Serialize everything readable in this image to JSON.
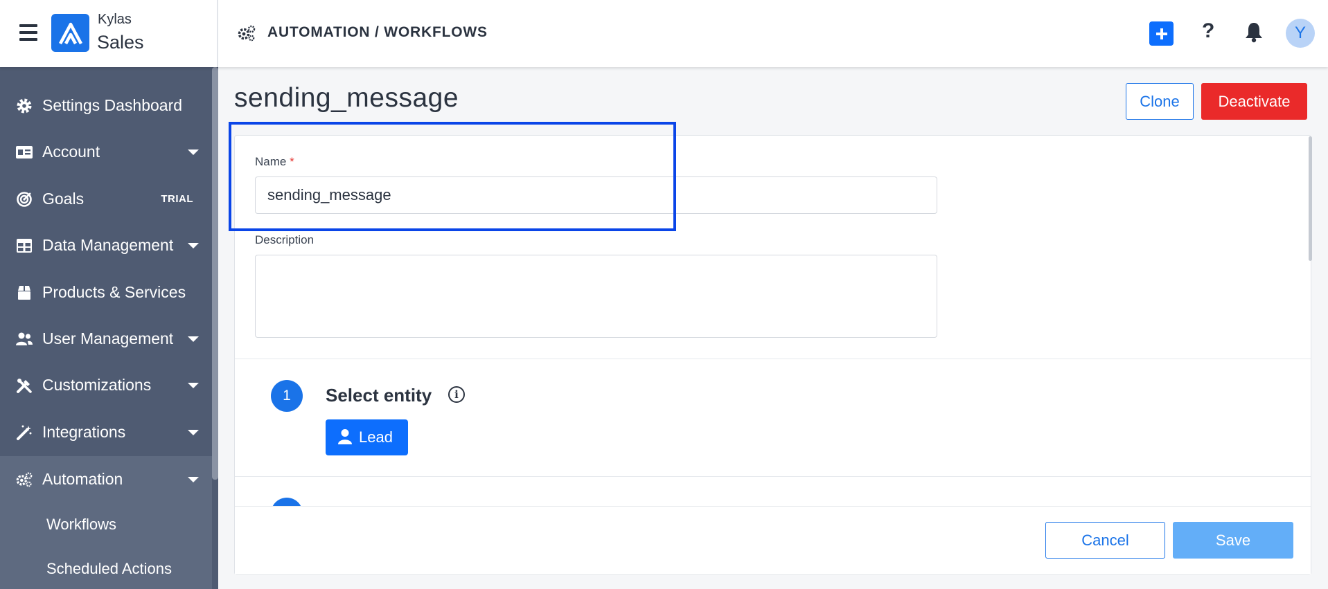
{
  "app": {
    "brand_top": "Kylas",
    "brand_bottom": "Sales",
    "breadcrumb": "AUTOMATION / WORKFLOWS",
    "avatar_initial": "Y",
    "help_glyph": "?"
  },
  "colors": {
    "primary": "#1a73e8",
    "danger": "#ea2a2a",
    "sidebar_bg": "#4f5b72",
    "save_disabled": "#63aef8"
  },
  "sidebar": {
    "items": [
      {
        "label": "Settings Dashboard",
        "icon": "gear-icon",
        "has_caret": false
      },
      {
        "label": "Account",
        "icon": "id-card-icon",
        "has_caret": true
      },
      {
        "label": "Goals",
        "icon": "target-icon",
        "badge": "TRIAL",
        "has_caret": false
      },
      {
        "label": "Data Management",
        "icon": "table-icon",
        "has_caret": true
      },
      {
        "label": "Products & Services",
        "icon": "box-icon",
        "has_caret": false
      },
      {
        "label": "User Management",
        "icon": "users-icon",
        "has_caret": true
      },
      {
        "label": "Customizations",
        "icon": "tools-icon",
        "has_caret": true
      },
      {
        "label": "Integrations",
        "icon": "magic-wand-icon",
        "has_caret": true
      },
      {
        "label": "Automation",
        "icon": "gears-icon",
        "has_caret": true,
        "active": true
      }
    ],
    "subitems": [
      {
        "label": "Workflows"
      },
      {
        "label": "Scheduled Actions"
      }
    ]
  },
  "main": {
    "title": "sending_message",
    "clone_label": "Clone",
    "deactivate_label": "Deactivate",
    "form": {
      "name_label": "Name",
      "required_mark": "*",
      "name_value": "sending_message",
      "description_label": "Description",
      "description_value": ""
    },
    "steps": [
      {
        "number": "1",
        "title": "Select entity",
        "selected_entity": "Lead",
        "info_glyph": "i"
      }
    ],
    "cancel_label": "Cancel",
    "save_label": "Save"
  }
}
